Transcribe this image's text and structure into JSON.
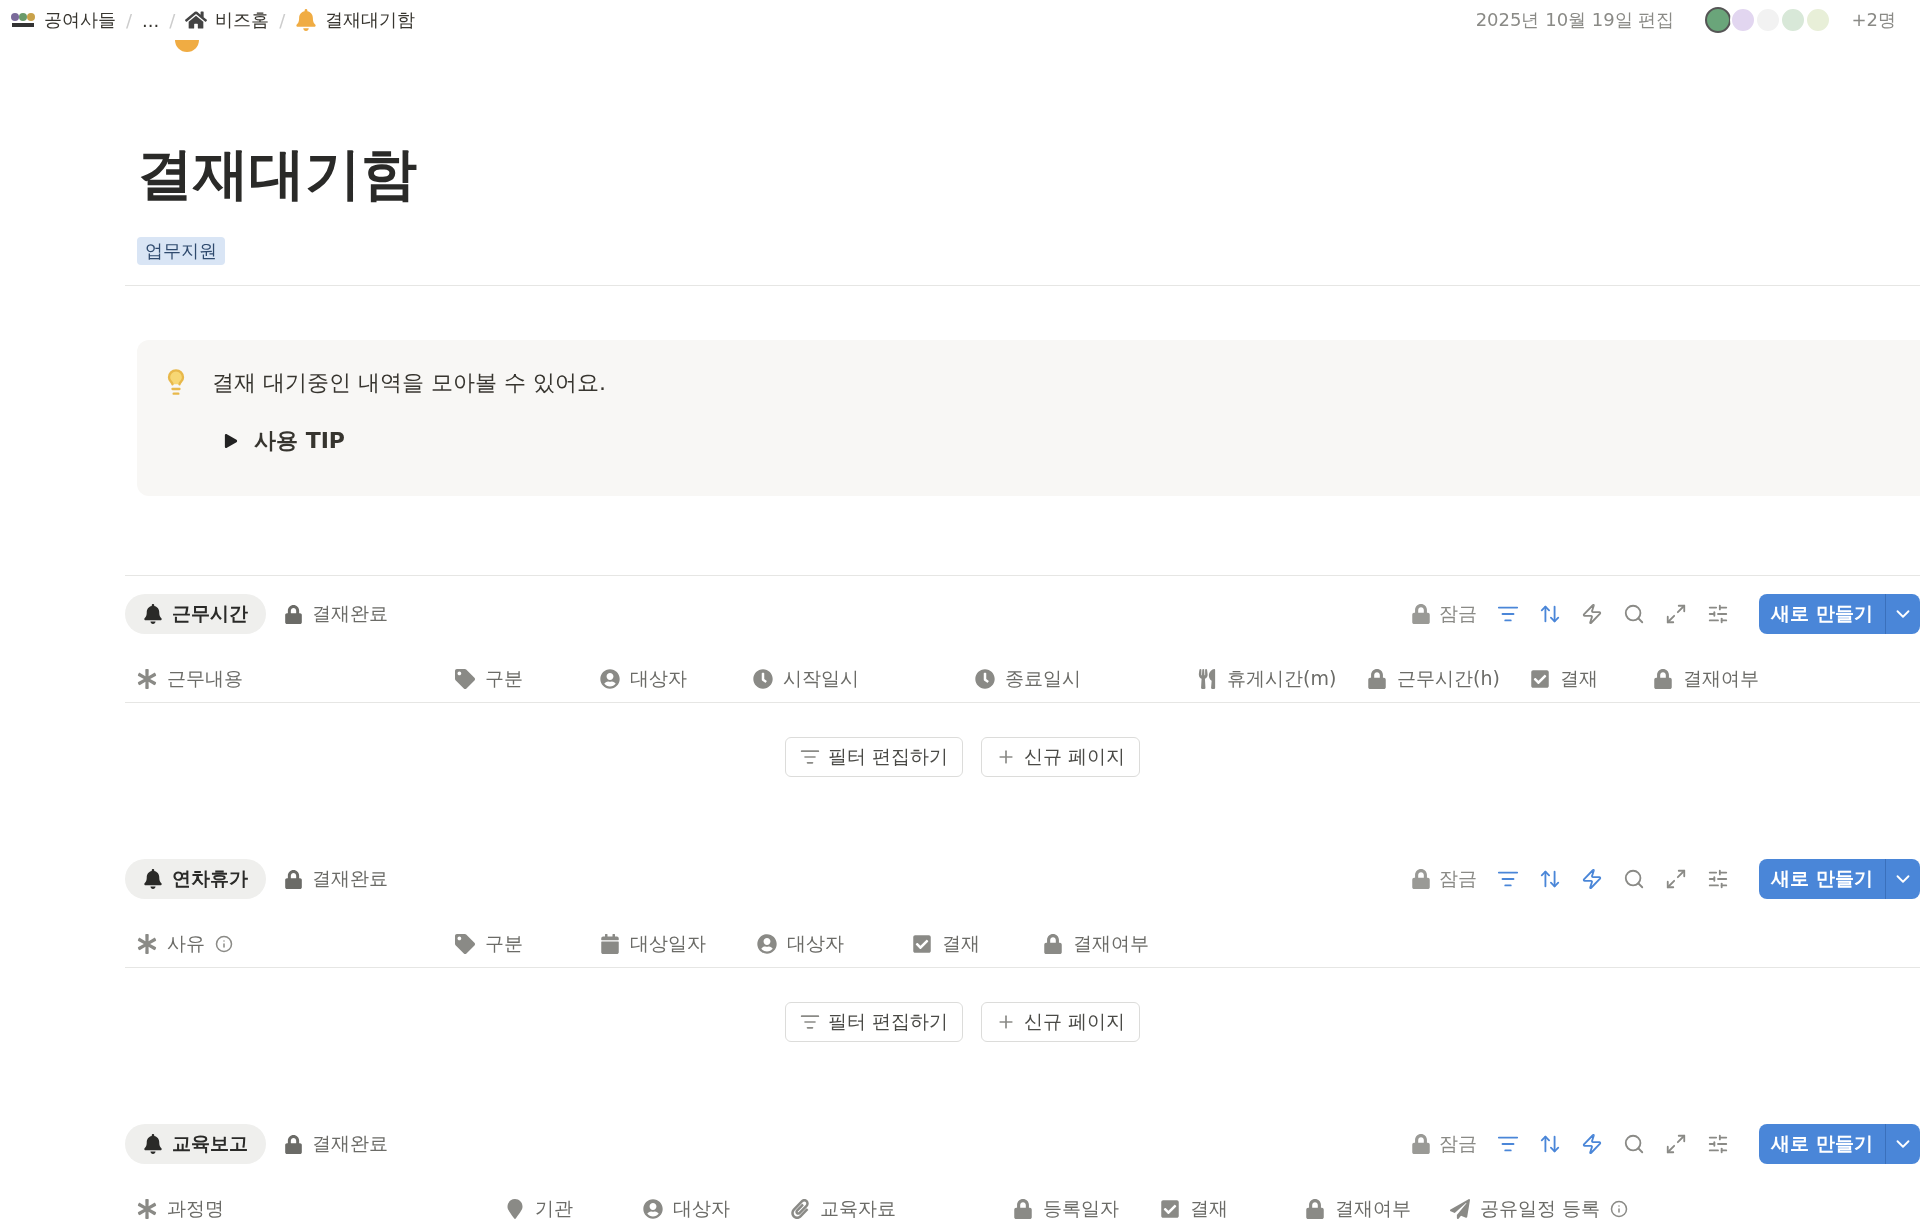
{
  "breadcrumb": [
    {
      "label": "공여사들",
      "kind": "logo"
    },
    {
      "label": "...",
      "kind": "plain"
    },
    {
      "label": "비즈홈",
      "kind": "home"
    },
    {
      "label": "결재대기함",
      "kind": "bell"
    }
  ],
  "breadcrumb_separators": [
    "/",
    "/",
    "/"
  ],
  "edited": "2025년 10월 19일 편집",
  "more_users": "+2명",
  "title": "결재대기함",
  "tags": [
    "업무지원"
  ],
  "callout": {
    "text": "결재 대기중인 내역을 모아볼 수 있어요.",
    "toggle": {
      "label": "사용 TIP",
      "expanded": false
    }
  },
  "sections": [
    {
      "tabs": [
        {
          "label": "근무시간",
          "kind": "bell",
          "selected": true
        },
        {
          "label": "결재완료",
          "kind": "lock",
          "selected": false
        }
      ],
      "lock_label": "잠금",
      "filter_active": true,
      "sort_active": true,
      "automation_active": false,
      "new_button": "새로 만들기",
      "columns": [
        {
          "label": "근무내용",
          "kind": "asterisk",
          "info": false
        },
        {
          "label": "구분",
          "kind": "tag",
          "info": false
        },
        {
          "label": "대상자",
          "kind": "person",
          "info": false
        },
        {
          "label": "시작일시",
          "kind": "clock",
          "info": false
        },
        {
          "label": "종료일시",
          "kind": "clock",
          "info": false
        },
        {
          "label": "휴게시간(m)",
          "kind": "fork",
          "info": false
        },
        {
          "label": "근무시간(h)",
          "kind": "lock",
          "info": false
        },
        {
          "label": "결재",
          "kind": "checkbox",
          "info": false
        },
        {
          "label": "결재여부",
          "kind": "lock",
          "info": false
        }
      ],
      "empty_actions": [
        {
          "label": "필터 편집하기",
          "kind": "filter"
        },
        {
          "label": "신규 페이지",
          "kind": "plus"
        }
      ]
    },
    {
      "tabs": [
        {
          "label": "연차휴가",
          "kind": "bell",
          "selected": true
        },
        {
          "label": "결재완료",
          "kind": "lock",
          "selected": false
        }
      ],
      "lock_label": "잠금",
      "filter_active": true,
      "sort_active": true,
      "automation_active": true,
      "new_button": "새로 만들기",
      "columns": [
        {
          "label": "사유",
          "kind": "asterisk",
          "info": true
        },
        {
          "label": "구분",
          "kind": "tag",
          "info": false
        },
        {
          "label": "대상일자",
          "kind": "calendar",
          "info": false
        },
        {
          "label": "대상자",
          "kind": "person",
          "info": false
        },
        {
          "label": "결재",
          "kind": "checkbox",
          "info": false
        },
        {
          "label": "결재여부",
          "kind": "lock",
          "info": false
        }
      ],
      "empty_actions": [
        {
          "label": "필터 편집하기",
          "kind": "filter"
        },
        {
          "label": "신규 페이지",
          "kind": "plus"
        }
      ]
    },
    {
      "tabs": [
        {
          "label": "교육보고",
          "kind": "bell",
          "selected": true
        },
        {
          "label": "결재완료",
          "kind": "lock",
          "selected": false
        }
      ],
      "lock_label": "잠금",
      "filter_active": true,
      "sort_active": true,
      "automation_active": true,
      "new_button": "새로 만들기",
      "columns": [
        {
          "label": "과정명",
          "kind": "asterisk",
          "info": false
        },
        {
          "label": "기관",
          "kind": "pin",
          "info": false
        },
        {
          "label": "대상자",
          "kind": "person",
          "info": false
        },
        {
          "label": "교육자료",
          "kind": "link",
          "info": false
        },
        {
          "label": "등록일자",
          "kind": "lock",
          "info": false
        },
        {
          "label": "결재",
          "kind": "checkbox",
          "info": false
        },
        {
          "label": "결재여부",
          "kind": "lock",
          "info": false
        },
        {
          "label": "공유일정 등록",
          "kind": "send",
          "info": true
        }
      ]
    }
  ]
}
